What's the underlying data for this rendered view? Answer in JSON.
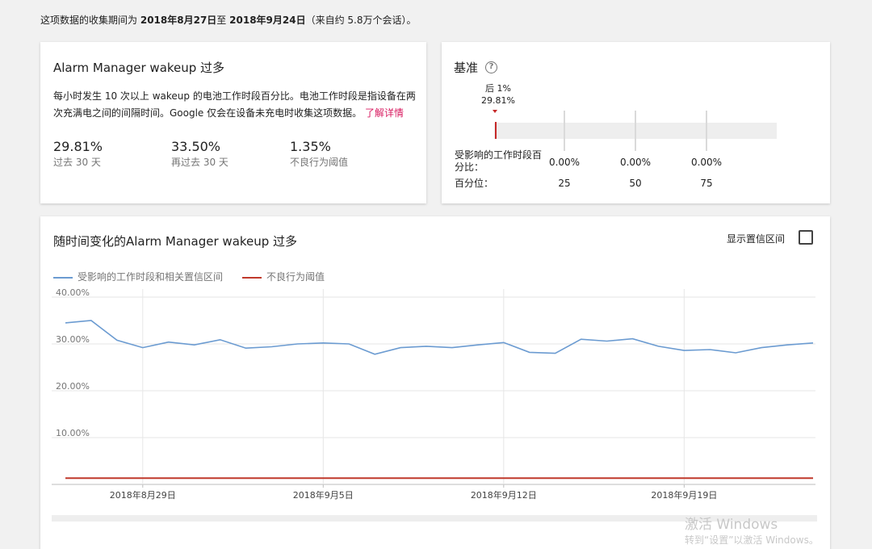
{
  "header": {
    "prefix": "这项数据的收集期间为",
    "start_date": "2018年8月27日",
    "middle": "至",
    "end_date": "2018年9月24日",
    "suffix": "（来自约 5.8万个会话）。"
  },
  "summary": {
    "title": "Alarm Manager wakeup 过多",
    "description": "每小时发生 10 次以上 wakeup 的电池工作时段百分比。电池工作时段是指设备在两次充满电之间的间隔时间。Google 仅会在设备未充电时收集这项数据。",
    "learn_more": "了解详情",
    "metrics": [
      {
        "value": "29.81%",
        "label": "过去 30 天"
      },
      {
        "value": "33.50%",
        "label": "再过去 30 天"
      },
      {
        "value": "1.35%",
        "label": "不良行为阈值"
      }
    ]
  },
  "benchmark": {
    "title": "基准",
    "help_icon": "help-circle-icon",
    "marker_label": "后 1%",
    "marker_value": "29.81%",
    "row1_label": "受影响的工作时段百分比：",
    "row1_values": [
      "0.00%",
      "0.00%",
      "0.00%"
    ],
    "row2_label": "百分位：",
    "row2_values": [
      "25",
      "50",
      "75"
    ]
  },
  "chart_card": {
    "title": "随时间变化的Alarm Manager wakeup 过多",
    "ci_label": "显示置信区间",
    "ci_checked": false
  },
  "chart_data": {
    "type": "line",
    "ylabel": "",
    "xlabel": "",
    "ylim": [
      0,
      40
    ],
    "y_ticks": [
      "40.00%",
      "30.00%",
      "20.00%",
      "10.00%"
    ],
    "x_tick_labels": [
      "2018年8月29日",
      "2018年9月5日",
      "2018年9月12日",
      "2018年9月19日"
    ],
    "x": [
      "2018-08-26",
      "2018-08-27",
      "2018-08-28",
      "2018-08-29",
      "2018-08-30",
      "2018-08-31",
      "2018-09-01",
      "2018-09-02",
      "2018-09-03",
      "2018-09-04",
      "2018-09-05",
      "2018-09-06",
      "2018-09-07",
      "2018-09-08",
      "2018-09-09",
      "2018-09-10",
      "2018-09-11",
      "2018-09-12",
      "2018-09-13",
      "2018-09-14",
      "2018-09-15",
      "2018-09-16",
      "2018-09-17",
      "2018-09-18",
      "2018-09-19",
      "2018-09-20",
      "2018-09-21",
      "2018-09-22",
      "2018-09-23",
      "2018-09-24"
    ],
    "series": [
      {
        "name": "受影响的工作时段和相关置信区间",
        "color": "#6b9bd1",
        "values": [
          34.5,
          35.0,
          30.8,
          29.2,
          30.4,
          29.8,
          30.9,
          29.1,
          29.4,
          30.0,
          30.2,
          30.0,
          27.8,
          29.2,
          29.5,
          29.2,
          29.8,
          30.3,
          28.2,
          28.0,
          31.0,
          30.6,
          31.1,
          29.5,
          28.6,
          28.8,
          28.1,
          29.2,
          29.8,
          30.2
        ]
      },
      {
        "name": "不良行为阈值",
        "color": "#c0392b",
        "values": [
          1.35,
          1.35,
          1.35,
          1.35,
          1.35,
          1.35,
          1.35,
          1.35,
          1.35,
          1.35,
          1.35,
          1.35,
          1.35,
          1.35,
          1.35,
          1.35,
          1.35,
          1.35,
          1.35,
          1.35,
          1.35,
          1.35,
          1.35,
          1.35,
          1.35,
          1.35,
          1.35,
          1.35,
          1.35,
          1.35
        ]
      }
    ],
    "grid": true,
    "legend": "top-left"
  },
  "watermark": {
    "line1": "激活 Windows",
    "line2": "转到“设置”以激活 Windows。"
  }
}
